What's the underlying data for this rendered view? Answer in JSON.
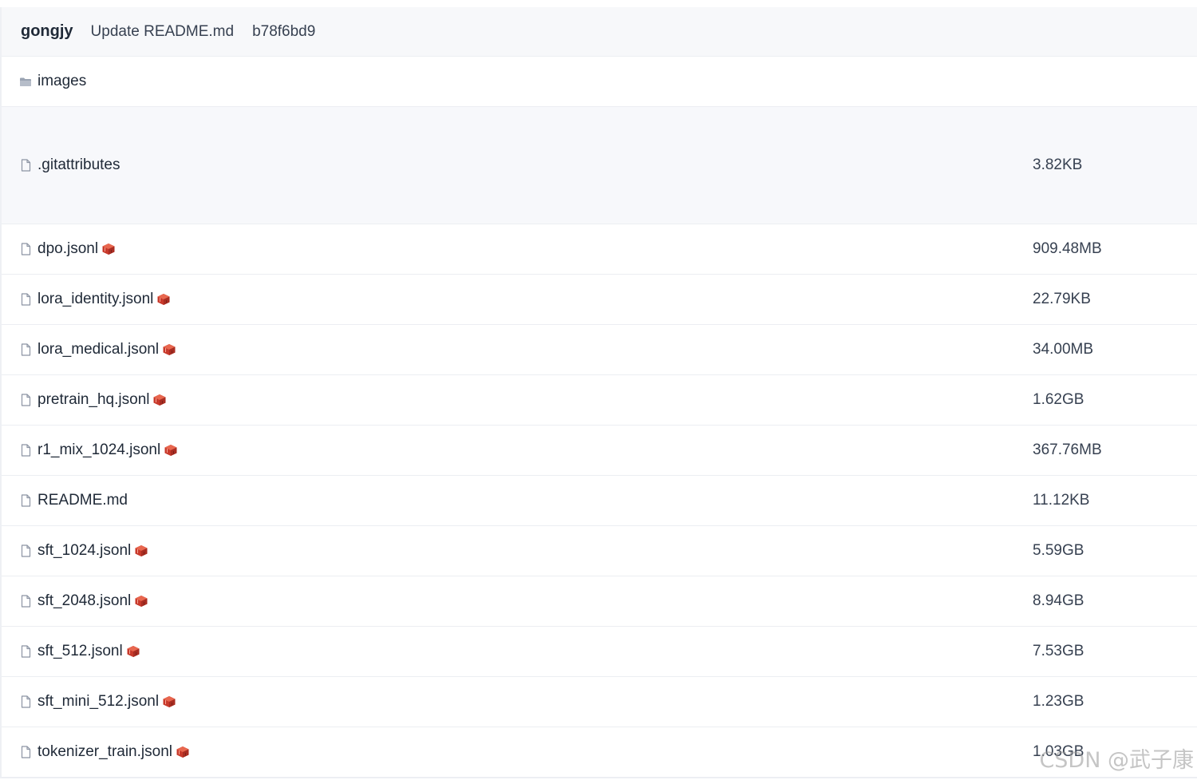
{
  "commit": {
    "author": "gongjy",
    "message": "Update README.md",
    "hash": "b78f6bd9"
  },
  "files": [
    {
      "name": "images",
      "type": "folder",
      "size": "",
      "lfs": false
    },
    {
      "name": ".gitattributes",
      "type": "file",
      "size": "3.82KB",
      "lfs": false
    },
    {
      "name": "dpo.jsonl",
      "type": "file",
      "size": "909.48MB",
      "lfs": true
    },
    {
      "name": "lora_identity.jsonl",
      "type": "file",
      "size": "22.79KB",
      "lfs": true
    },
    {
      "name": "lora_medical.jsonl",
      "type": "file",
      "size": "34.00MB",
      "lfs": true
    },
    {
      "name": "pretrain_hq.jsonl",
      "type": "file",
      "size": "1.62GB",
      "lfs": true
    },
    {
      "name": "r1_mix_1024.jsonl",
      "type": "file",
      "size": "367.76MB",
      "lfs": true
    },
    {
      "name": "README.md",
      "type": "file",
      "size": "11.12KB",
      "lfs": false
    },
    {
      "name": "sft_1024.jsonl",
      "type": "file",
      "size": "5.59GB",
      "lfs": true
    },
    {
      "name": "sft_2048.jsonl",
      "type": "file",
      "size": "8.94GB",
      "lfs": true
    },
    {
      "name": "sft_512.jsonl",
      "type": "file",
      "size": "7.53GB",
      "lfs": true
    },
    {
      "name": "sft_mini_512.jsonl",
      "type": "file",
      "size": "1.23GB",
      "lfs": true
    },
    {
      "name": "tokenizer_train.jsonl",
      "type": "file",
      "size": "1.03GB",
      "lfs": true
    }
  ],
  "watermark": "CSDN @武子康",
  "colors": {
    "lfs_icon": "#d9442f",
    "header_bg": "#f7f8fa"
  }
}
